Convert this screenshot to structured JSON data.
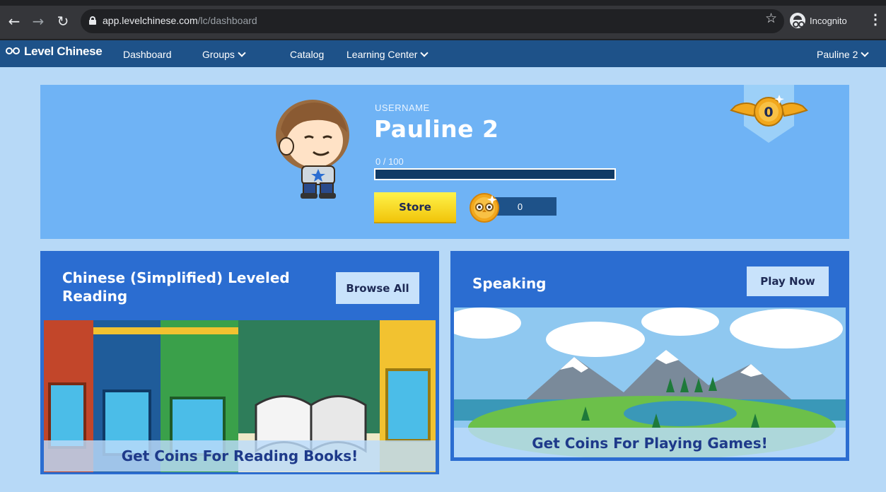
{
  "browser": {
    "url_host": "app.levelchinese.com",
    "url_path": "/lc/dashboard",
    "incognito_label": "Incognito"
  },
  "navbar": {
    "brand": "Level Chinese",
    "items": [
      {
        "label": "Dashboard"
      },
      {
        "label": "Groups"
      },
      {
        "label": "Catalog"
      },
      {
        "label": "Learning Center"
      }
    ],
    "user_label": "Pauline 2"
  },
  "profile": {
    "username_label": "USERNAME",
    "username": "Pauline 2",
    "xp_text": "0 / 100",
    "xp_progress": 0,
    "store_label": "Store",
    "coins": "0",
    "rank_level": "0"
  },
  "cards": {
    "reading": {
      "title": "Chinese (Simplified) Leveled Reading",
      "button": "Browse All",
      "caption": "Get Coins For Reading Books!"
    },
    "speaking": {
      "title": "Speaking",
      "button": "Play Now",
      "caption": "Get Coins For Playing Games!"
    }
  },
  "colors": {
    "navbar": "#1e5289",
    "page_bg": "#b7d9f7",
    "profile_bg": "#6fb3f5",
    "card_bg": "#2b6dd1",
    "store_yellow": "#f1c40a"
  }
}
